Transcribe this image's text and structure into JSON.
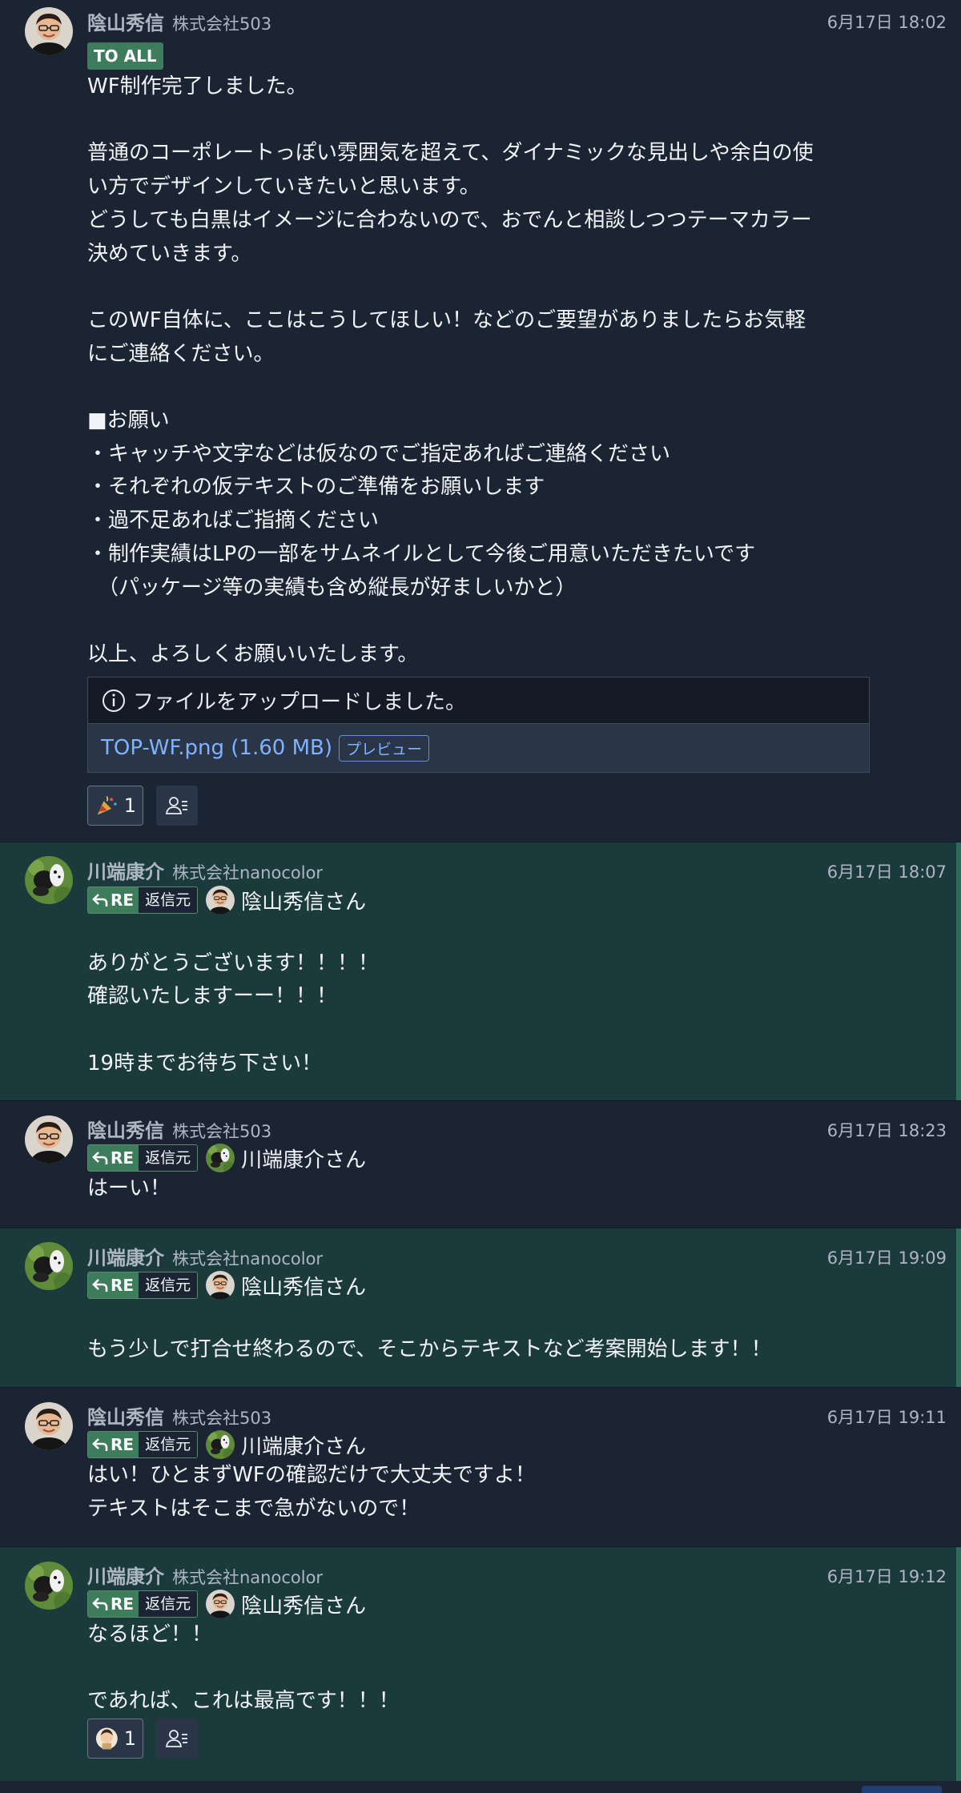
{
  "messages": [
    {
      "author": "陰山秀信",
      "company": "株式会社503",
      "time": "6月17日 18:02",
      "badge": "TO ALL",
      "lines": "WF制作完了しました。\n\n普通のコーポレートっぽい雰囲気を超えて、ダイナミックな見出しや余白の使\nい方でデザインしていきたいと思います。\nどうしても白黒はイメージに合わないので、おでんと相談しつつテーマカラー\n決めていきます。\n\nこのWF自体に、ここはこうしてほしい！などのご要望がありましたらお気軽\nにご連絡ください。\n\n■お願い\n・キャッチや文字などは仮なのでご指定あればご連絡ください\n・それぞれの仮テキストのご準備をお願いします\n・過不足あればご指摘ください\n・制作実績はLPの一部をサムネイルとして今後ご用意いただきたいです\n　（パッケージ等の実績も含め縦長が好ましいかと）\n\n以上、よろしくお願いいたします。",
      "file": {
        "notice": "ファイルをアップロードしました。",
        "link": "TOP-WF.png (1.60 MB)",
        "preview": "プレビュー"
      },
      "reaction": {
        "icon": "party-popper-icon",
        "count": "1"
      }
    },
    {
      "author": "川端康介",
      "company": "株式会社nanocolor",
      "time": "6月17日 18:07",
      "re": "RE",
      "re_label": "返信元",
      "reply_to": "陰山秀信さん",
      "lines": "\nありがとうございます！！！！\n確認いたしますーー！！！\n\n19時までお待ち下さい！"
    },
    {
      "author": "陰山秀信",
      "company": "株式会社503",
      "time": "6月17日 18:23",
      "re": "RE",
      "re_label": "返信元",
      "reply_to": "川端康介さん",
      "lines": "はーい！"
    },
    {
      "author": "川端康介",
      "company": "株式会社nanocolor",
      "time": "6月17日 19:09",
      "re": "RE",
      "re_label": "返信元",
      "reply_to": "陰山秀信さん",
      "lines": "\nもう少しで打合せ終わるので、そこからテキストなど考案開始します！！"
    },
    {
      "author": "陰山秀信",
      "company": "株式会社503",
      "time": "6月17日 19:11",
      "re": "RE",
      "re_label": "返信元",
      "reply_to": "川端康介さん",
      "lines": "はい！ひとまずWFの確認だけで大丈夫ですよ！\nテキストはそこまで急がないので！"
    },
    {
      "author": "川端康介",
      "company": "株式会社nanocolor",
      "time": "6月17日 19:12",
      "re": "RE",
      "re_label": "返信元",
      "reply_to": "陰山秀信さん",
      "lines": "なるほど！！\n\nであれば、これは最高です！！！",
      "reaction": {
        "icon": "avatar-emoji-icon",
        "count": "1"
      }
    }
  ]
}
